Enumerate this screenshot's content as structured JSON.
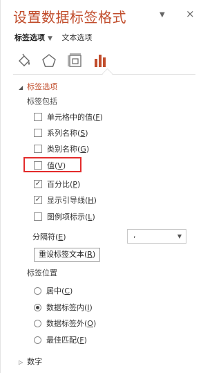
{
  "panel": {
    "title": "设置数据标签格式",
    "minimize_glyph": "▼",
    "close_glyph": "×"
  },
  "tabs": [
    {
      "label": "标签选项",
      "caret": "▼"
    },
    {
      "label": "文本选项"
    }
  ],
  "icon_tabs": [
    "fill-line-icon",
    "effects-pentagon-icon",
    "size-properties-icon",
    "label-options-barchart-icon"
  ],
  "colors": {
    "accent": "#c14d2c",
    "highlight": "#e32b2b"
  },
  "label_options": {
    "header": "标签选项",
    "label_contains_heading": "标签包括",
    "checkboxes": [
      {
        "text": "单元格中的值(",
        "key": "F",
        "end": ")",
        "checked": false,
        "glyph": ""
      },
      {
        "text": "系列名称(",
        "key": "S",
        "end": ")",
        "checked": false,
        "glyph": ""
      },
      {
        "text": "类别名称(",
        "key": "G",
        "end": ")",
        "checked": false,
        "glyph": ""
      },
      {
        "text": "值(",
        "key": "V",
        "end": ")",
        "checked": false,
        "glyph": ""
      },
      {
        "text": "百分比(",
        "key": "P",
        "end": ")",
        "checked": true,
        "glyph": "✓"
      },
      {
        "text": "显示引导线(",
        "key": "H",
        "end": ")",
        "checked": true,
        "glyph": "✓"
      },
      {
        "text": "图例项标示(",
        "key": "L",
        "end": ")",
        "checked": false,
        "glyph": ""
      }
    ],
    "separator": {
      "label": "分隔符(",
      "key": "E",
      "end": ")",
      "value": ","
    },
    "reset_button": {
      "text": "重设标签文本(",
      "key": "R",
      "end": ")"
    },
    "position_heading": "标签位置",
    "positions": [
      {
        "text": "居中(",
        "key": "C",
        "end": ")",
        "selected": false
      },
      {
        "text": "数据标签内(",
        "key": "I",
        "end": ")",
        "selected": true
      },
      {
        "text": "数据标签外(",
        "key": "O",
        "end": ")",
        "selected": false
      },
      {
        "text": "最佳匹配(",
        "key": "F",
        "end": ")",
        "selected": false
      }
    ]
  },
  "number_section": {
    "header": "数字"
  }
}
